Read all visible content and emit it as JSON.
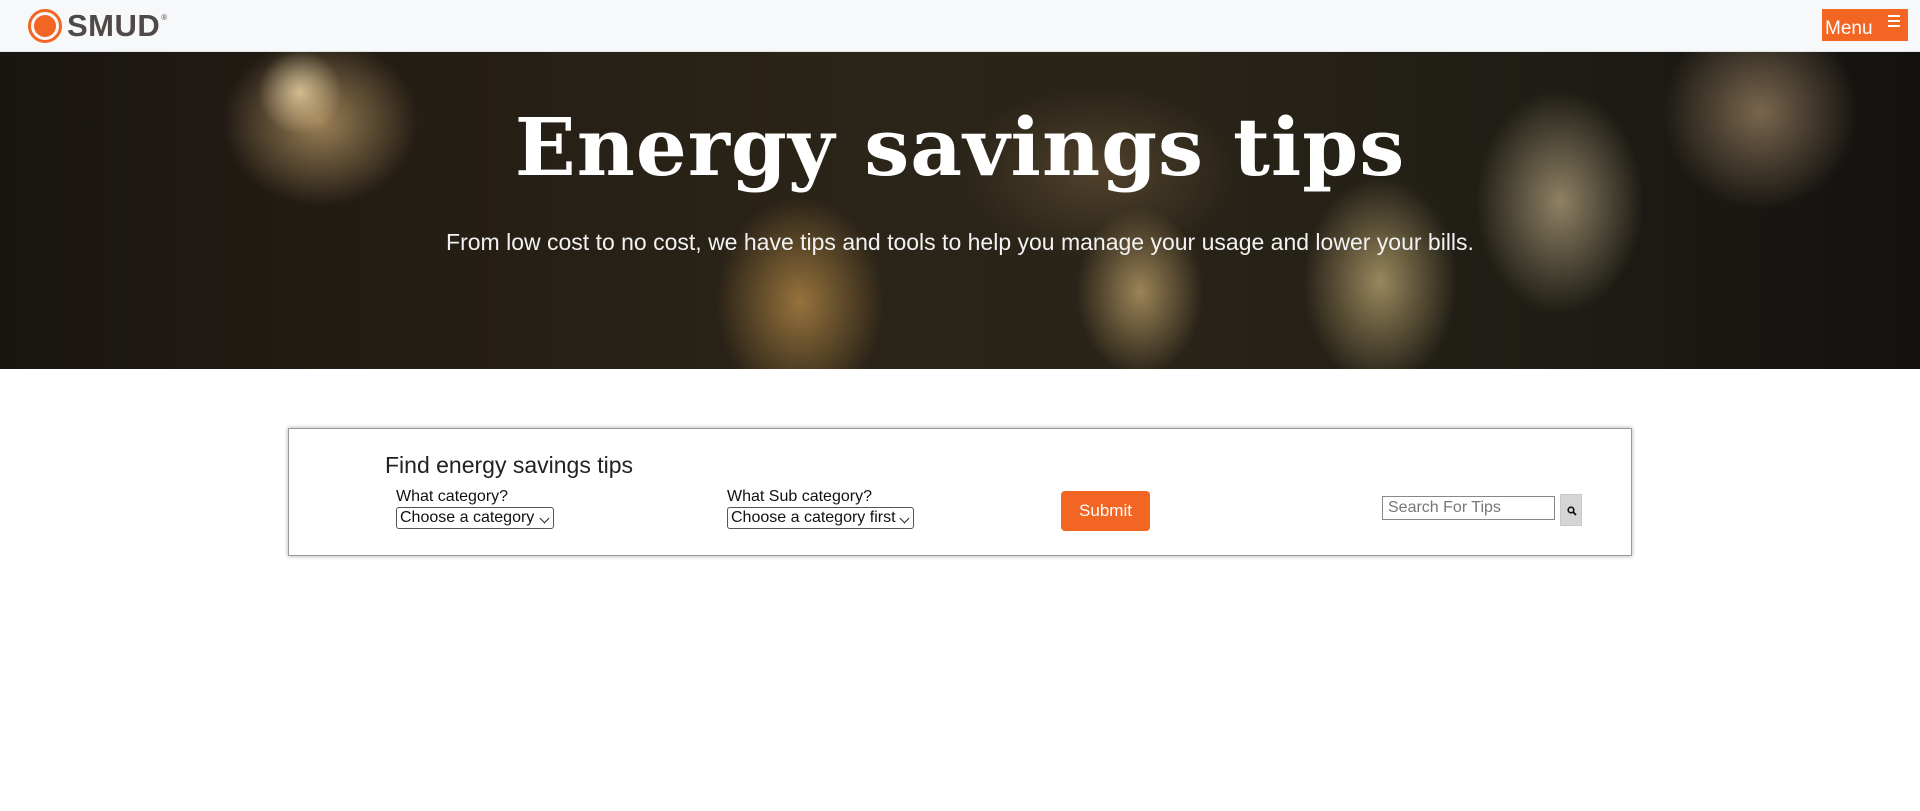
{
  "header": {
    "logo_text": "SMUD",
    "logo_reg": "®",
    "menu_label": "Menu",
    "menu_icon": "hamburger-icon",
    "brand_color": "#f26522"
  },
  "hero": {
    "title": "Energy savings tips",
    "subtitle": "From low cost to no cost, we have tips and tools to help you manage your usage and lower your bills."
  },
  "finder": {
    "title": "Find energy savings tips",
    "category_label": "What category?",
    "category_value": "Choose a category",
    "subcategory_label": "What Sub category?",
    "subcategory_value": "Choose a category first",
    "submit_label": "Submit",
    "search_placeholder": "Search For Tips",
    "search_icon": "search-icon"
  }
}
